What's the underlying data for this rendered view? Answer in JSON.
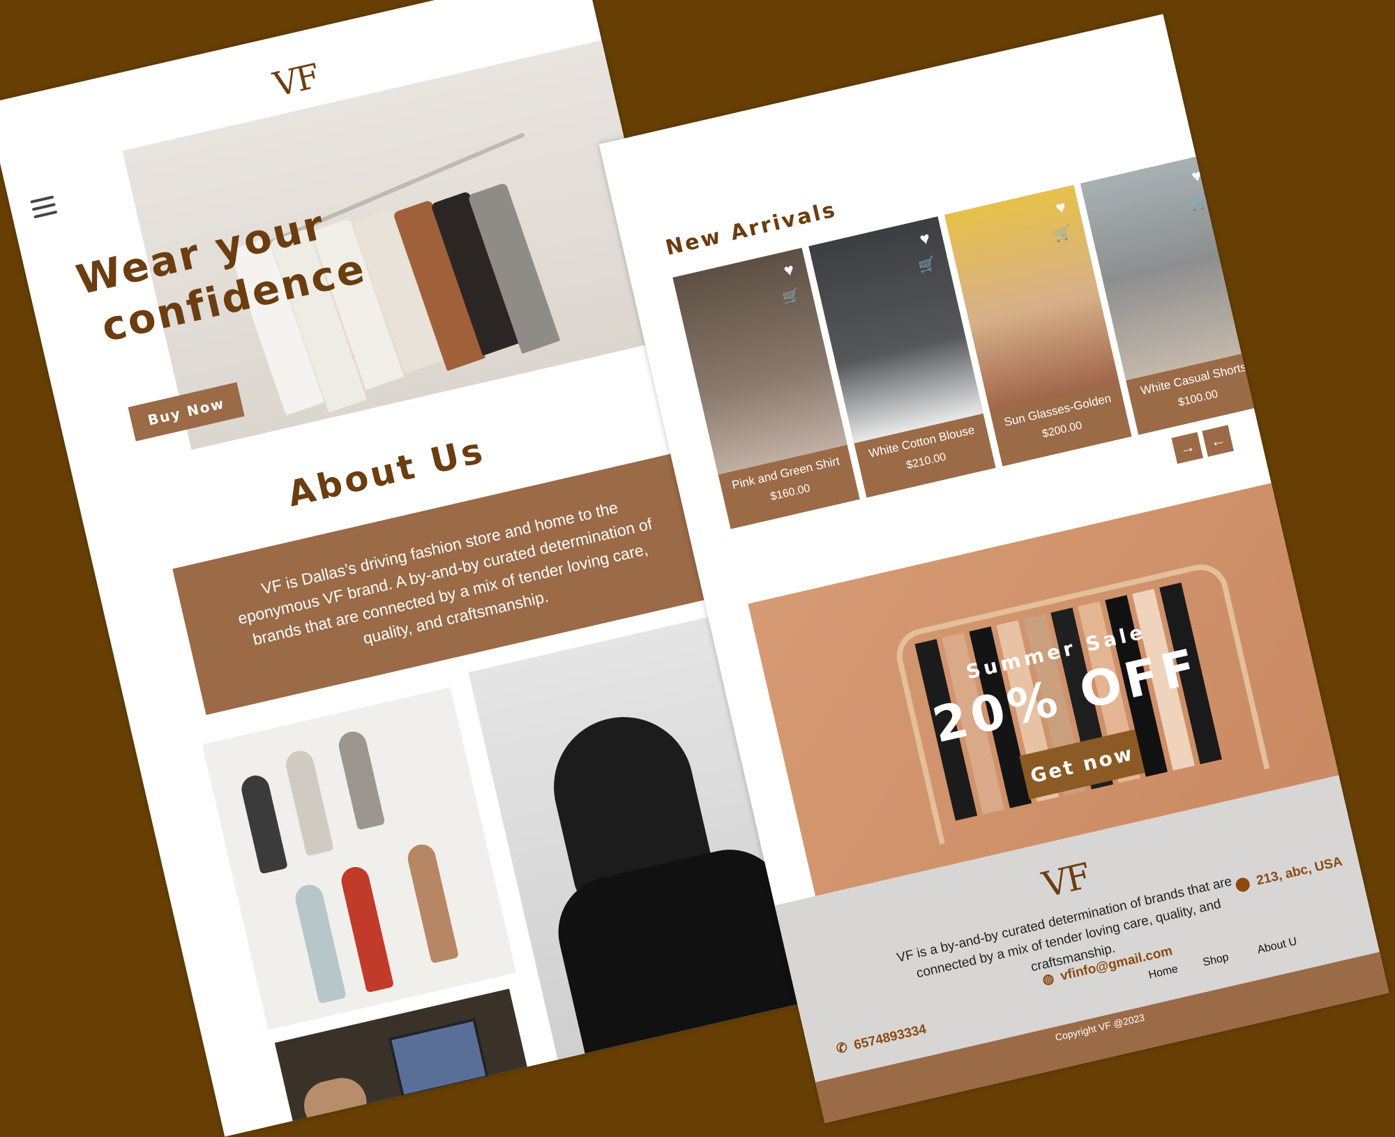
{
  "colors": {
    "background": "#673f05",
    "accent": "#9b6a47",
    "brand_text": "#6b3d10",
    "footer_bg": "#d8d6d5"
  },
  "left_page": {
    "logo": "VF",
    "menu_icon": "hamburger-menu-icon",
    "hero": {
      "title_line1": "Wear your",
      "title_line2": "confidence",
      "button": "Buy Now"
    },
    "about": {
      "title": "About Us",
      "text": "VF is Dallas’s driving fashion store and home to the eponymous VF brand. A by-and-by curated determination of brands that are connected by a mix of tender loving care, quality, and craftsmanship."
    }
  },
  "right_page": {
    "new_arrivals": {
      "title": "New Arrivals",
      "products": [
        {
          "name": "Pink and Green Shirt",
          "price": "$160.00",
          "color": "#6d5d52"
        },
        {
          "name": "White Cotton Blouse",
          "price": "$210.00",
          "color": "#3c3e42"
        },
        {
          "name": "Sun Glasses-Golden",
          "price": "$200.00",
          "color": "#e7c14a"
        },
        {
          "name": "White Casual Shorts",
          "price": "$100.00",
          "color": "#8d8f8f"
        }
      ],
      "next_icon": "arrow-right-icon",
      "prev_icon": "arrow-left-icon"
    },
    "sale": {
      "subtitle": "Summer Sale",
      "headline": "20% OFF",
      "button": "Get now"
    },
    "footer": {
      "logo": "VF",
      "description": "VF  is a by-and-by curated determination of brands that are connected by a mix of tender loving care, quality, and craftsmanship.",
      "address": "213, abc, USA",
      "email": "vfinfo@gmail.com",
      "phone": "6574893334",
      "nav": [
        "Home",
        "Shop",
        "About U"
      ],
      "social": [
        "instagram-icon",
        "pinterest-icon",
        "behance-icon",
        "twitter-icon"
      ],
      "copyright": "Copyright VF @2023"
    }
  }
}
